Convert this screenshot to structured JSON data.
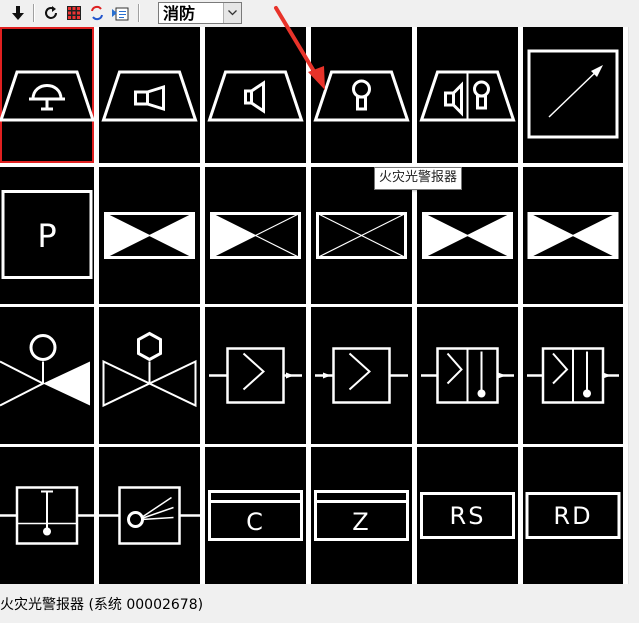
{
  "toolbar": {
    "icons": [
      "arrow-down-icon",
      "refresh-icon",
      "grid-view-icon",
      "swap-icon",
      "insert-icon"
    ],
    "category_value": "消防"
  },
  "grid": {
    "selected_index": 0,
    "cells": [
      {
        "symbol": "trapezoid-bell-alarm-icon"
      },
      {
        "symbol": "trapezoid-horn-icon"
      },
      {
        "symbol": "trapezoid-speaker-icon"
      },
      {
        "symbol": "trapezoid-light-alarm-icon"
      },
      {
        "symbol": "trapezoid-sound-light-alarm-icon"
      },
      {
        "symbol": "square-diagonal-arrow-icon"
      },
      {
        "symbol": "square-p-icon",
        "text": "P"
      },
      {
        "symbol": "valve-filled-both-icon"
      },
      {
        "symbol": "valve-filled-left-icon"
      },
      {
        "symbol": "valve-outline-icon"
      },
      {
        "symbol": "valve-filled-lower-icon"
      },
      {
        "symbol": "valve-filled-both-icon"
      },
      {
        "symbol": "globe-valve-circle-icon"
      },
      {
        "symbol": "globe-valve-polygon-icon"
      },
      {
        "symbol": "flow-switch-icon"
      },
      {
        "symbol": "flow-switch-reverse-icon"
      },
      {
        "symbol": "flow-switch-indicator-icon"
      },
      {
        "symbol": "flow-switch-indicator-icon"
      },
      {
        "symbol": "level-gauge-icon"
      },
      {
        "symbol": "spray-nozzle-icon"
      },
      {
        "symbol": "box-c-icon",
        "text": "C"
      },
      {
        "symbol": "box-z-icon",
        "text": "Z"
      },
      {
        "symbol": "box-rs-icon",
        "text": "RS"
      },
      {
        "symbol": "box-rd-icon",
        "text": "RD"
      }
    ]
  },
  "tooltip": "火灾光警报器",
  "status": "火灾光警报器 (系统 00002678)"
}
